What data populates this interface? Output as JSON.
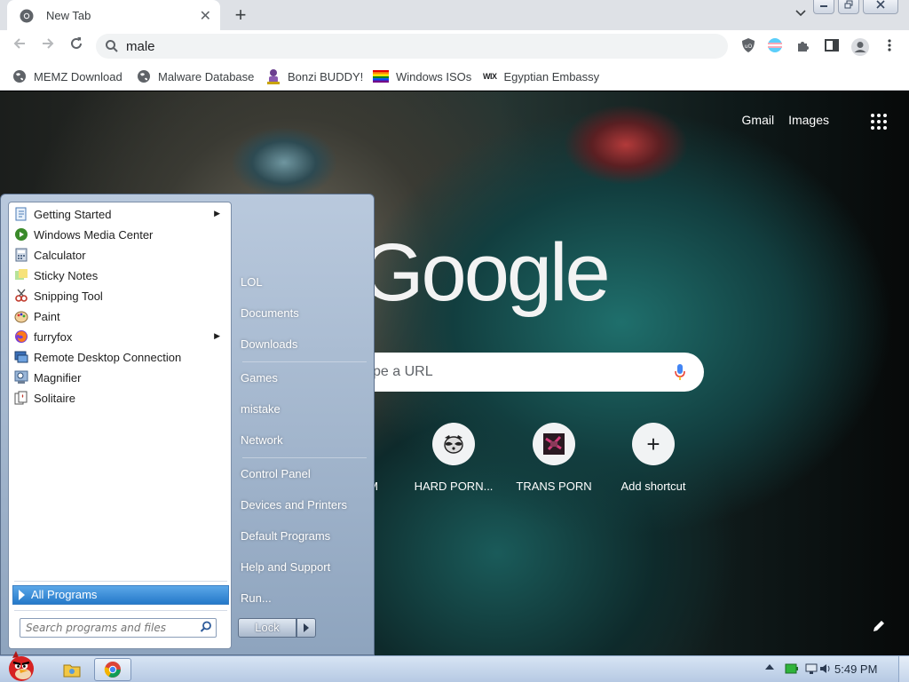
{
  "browser": {
    "tab": {
      "title": "New Tab",
      "close_glyph": "✕"
    },
    "new_tab_glyph": "+",
    "omnibox": {
      "value": "male"
    },
    "bookmarks": [
      {
        "label": "MEMZ Download",
        "icon": "globe-icon"
      },
      {
        "label": "Malware Database",
        "icon": "globe-icon"
      },
      {
        "label": "Bonzi BUDDY!",
        "icon": "bonzi-icon"
      },
      {
        "label": "Windows ISOs",
        "icon": "rainbow-flag-icon"
      },
      {
        "label": "Egyptian Embassy",
        "icon": "wix-icon"
      }
    ],
    "wix_text": "WIX"
  },
  "ntp": {
    "links": [
      "Gmail",
      "Images"
    ],
    "logo_text": "Google",
    "search_placeholder_visible": "pe a URL",
    "shortcuts": [
      {
        "label": "M",
        "icon": "partial-shortcut"
      },
      {
        "label": "HARD PORN...",
        "icon": "raccoon-icon"
      },
      {
        "label": "TRANS PORN",
        "icon": "site-thumbnail-icon"
      },
      {
        "label": "Add shortcut",
        "icon": "plus-icon"
      }
    ],
    "add_glyph": "+"
  },
  "start_menu": {
    "programs": [
      {
        "label": "Getting Started",
        "has_submenu": true,
        "icon": "getting-started-icon"
      },
      {
        "label": "Windows Media Center",
        "has_submenu": false,
        "icon": "media-center-icon"
      },
      {
        "label": "Calculator",
        "has_submenu": false,
        "icon": "calculator-icon"
      },
      {
        "label": "Sticky Notes",
        "has_submenu": false,
        "icon": "sticky-notes-icon"
      },
      {
        "label": "Snipping Tool",
        "has_submenu": false,
        "icon": "snipping-tool-icon"
      },
      {
        "label": "Paint",
        "has_submenu": false,
        "icon": "paint-icon"
      },
      {
        "label": "furryfox",
        "has_submenu": true,
        "icon": "firefox-icon"
      },
      {
        "label": "Remote Desktop Connection",
        "has_submenu": false,
        "icon": "remote-desktop-icon"
      },
      {
        "label": "Magnifier",
        "has_submenu": false,
        "icon": "magnifier-icon"
      },
      {
        "label": "Solitaire",
        "has_submenu": false,
        "icon": "solitaire-icon"
      }
    ],
    "all_programs": "All Programs",
    "search_placeholder": "Search programs and files",
    "places": [
      "LOL",
      "Documents",
      "Downloads",
      "Games",
      "mistake",
      "Network",
      "Control Panel",
      "Devices and Printers",
      "Default Programs",
      "Help and Support",
      "Run..."
    ],
    "lock_label": "Lock"
  },
  "taskbar": {
    "clock": "5:49 PM"
  },
  "colors": {
    "chrome_tabbar": "#dee1e6",
    "start_menu_bg": "#b9c9dd",
    "all_programs_highlight": "#2579c9",
    "taskbar": "#c9d8ec"
  }
}
